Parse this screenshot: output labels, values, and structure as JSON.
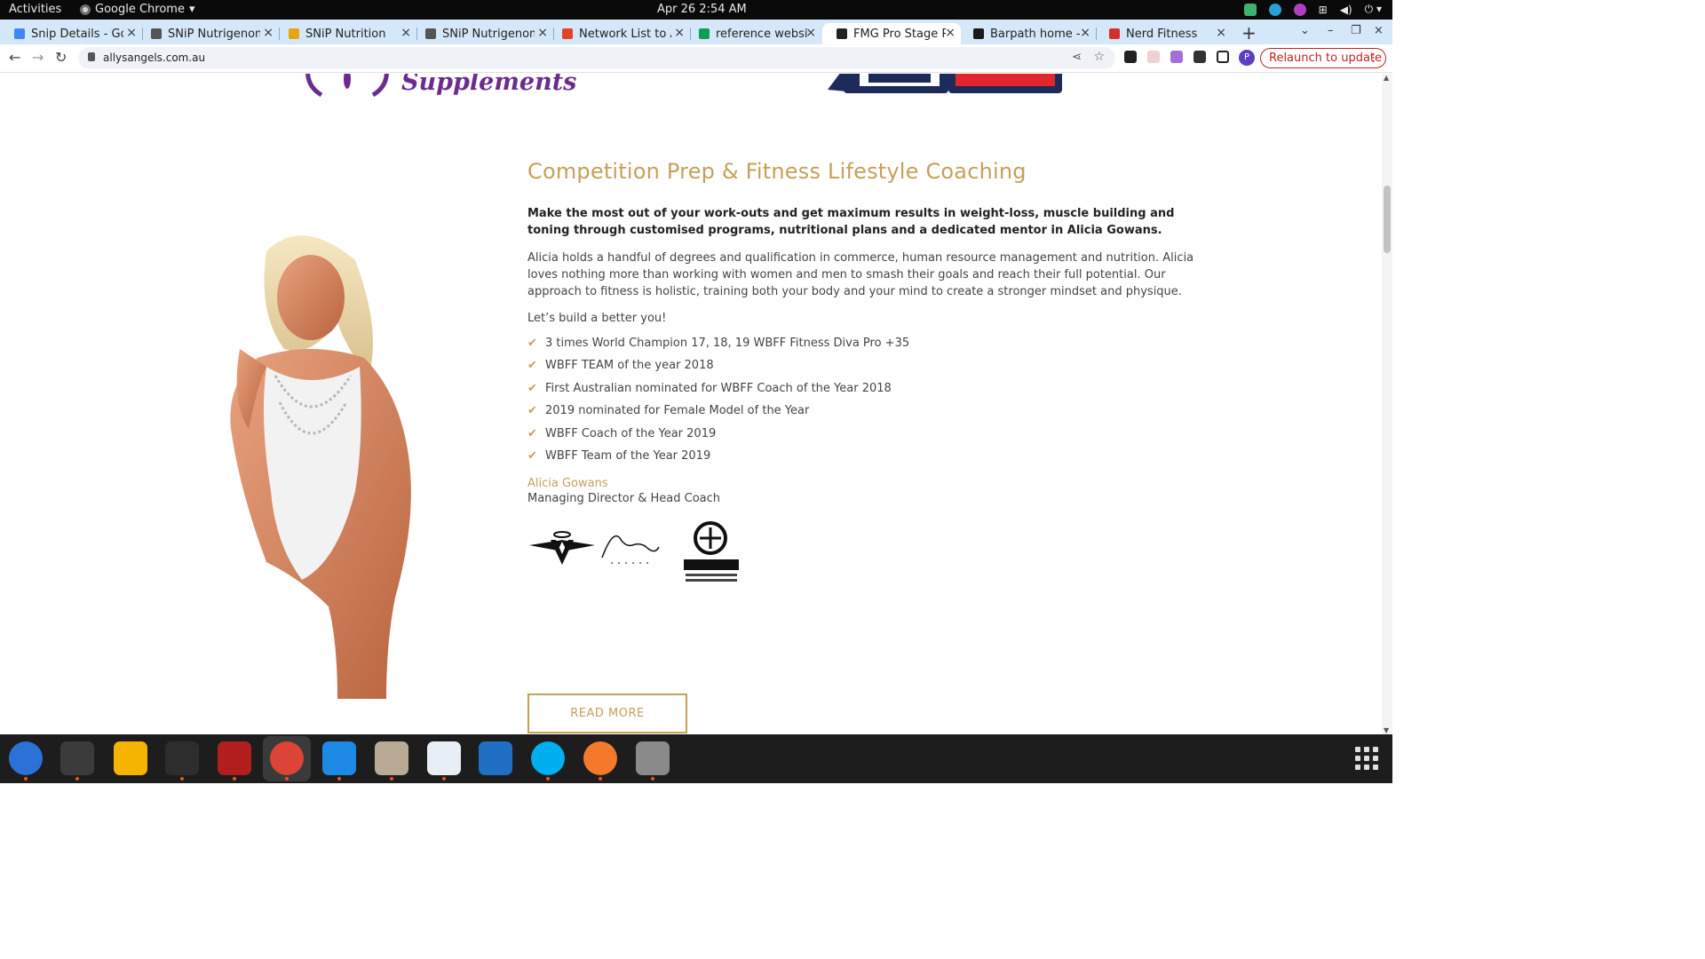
{
  "system": {
    "activities": "Activities",
    "app_name": "Google Chrome",
    "clock": "Apr 26  2:54 AM"
  },
  "tabs": [
    {
      "title": "Snip Details - Goo",
      "color": "#4285f4"
    },
    {
      "title": "SNiP Nutrigenomi",
      "color": "#555555"
    },
    {
      "title": "SNiP Nutrition",
      "color": "#e8a317"
    },
    {
      "title": "SNiP Nutrigenomi",
      "color": "#555555"
    },
    {
      "title": "Network List to Ac",
      "color": "#e24329"
    },
    {
      "title": "reference website",
      "color": "#0f9d58"
    },
    {
      "title": "FMG Pro Stage Po",
      "color": "#222222"
    },
    {
      "title": "Barpath home - Ba",
      "color": "#1a1a1a"
    },
    {
      "title": "Nerd Fitness",
      "color": "#d32f2f"
    }
  ],
  "address_bar": {
    "url": "allysangels.com.au",
    "relaunch": "Relaunch to update",
    "profile_initial": "P"
  },
  "page": {
    "logo_supplements": "Supplements",
    "headline": "Competition Prep & Fitness Lifestyle Coaching",
    "lead": "Make the most out of your work-outs and get maximum results in weight-loss, muscle building and toning through customised programs, nutritional plans and a dedicated mentor in Alicia Gowans.",
    "body": "Alicia holds a handful of degrees and qualification in commerce, human resource management and nutrition. Alicia loves nothing more than working with women and men to smash their goals and reach their full potential. Our approach to fitness is holistic, training both your body and your mind to create a stronger mindset and physique.",
    "cta_line": "Let’s build a better you!",
    "achievements": [
      "3 times World Champion 17, 18, 19 WBFF Fitness Diva Pro +35",
      "WBFF TEAM of the year 2018",
      "First Australian nominated for WBFF Coach of the Year 2018",
      "2019 nominated for Female Model of the Year",
      "WBFF Coach of the Year 2019",
      "WBFF Team of the Year 2019"
    ],
    "author_name": "Alicia Gowans",
    "author_title": "Managing Director & Head Coach",
    "read_more": "READ MORE",
    "accent_color": "#c5a059"
  },
  "dock_apps": [
    {
      "name": "thunderbird",
      "color": "#2a72d8"
    },
    {
      "name": "terminal",
      "color": "#3b3b3b"
    },
    {
      "name": "calculator",
      "color": "#f4b400"
    },
    {
      "name": "system-monitor",
      "color": "#2d2d2d"
    },
    {
      "name": "filezilla",
      "color": "#b21e1e"
    },
    {
      "name": "chrome",
      "color": "#db4437"
    },
    {
      "name": "vscode",
      "color": "#1e88e5"
    },
    {
      "name": "files",
      "color": "#b8aa94"
    },
    {
      "name": "text-editor",
      "color": "#e8eef6"
    },
    {
      "name": "libreoffice-writer",
      "color": "#1f6fc5"
    },
    {
      "name": "skype",
      "color": "#00aff0"
    },
    {
      "name": "blender",
      "color": "#f5792a"
    },
    {
      "name": "disks",
      "color": "#8a8a8a"
    }
  ]
}
